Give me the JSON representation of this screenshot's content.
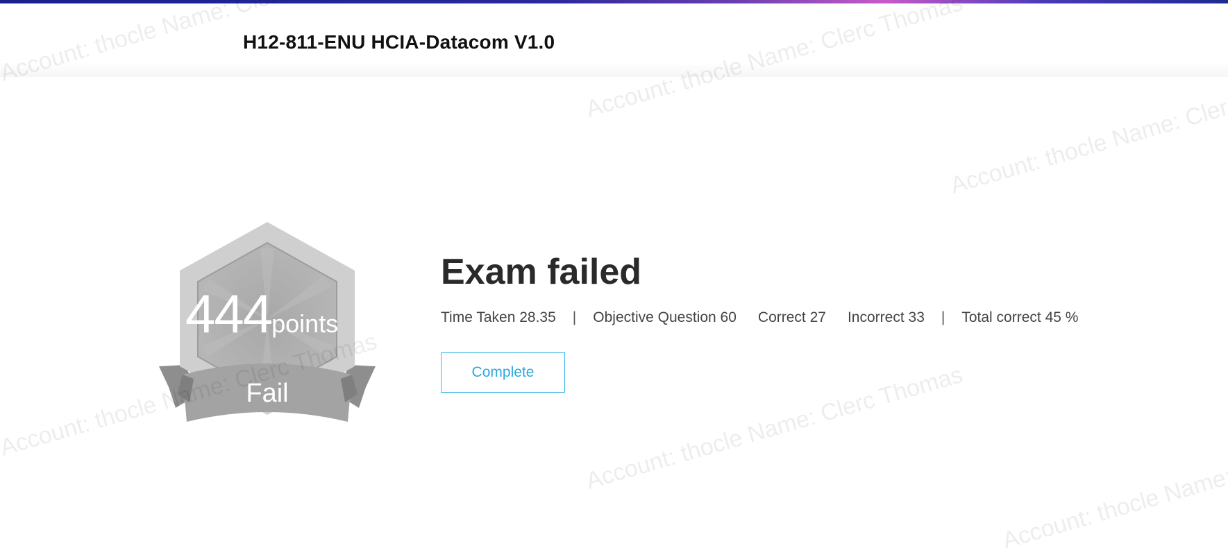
{
  "header": {
    "exam_title": "H12-811-ENU HCIA-Datacom V1.0"
  },
  "watermark": {
    "text": "Account: thocle Name: Clerc Thomas"
  },
  "badge": {
    "score": "444",
    "unit": "points",
    "result": "Fail",
    "color": "#b3b3b3"
  },
  "result": {
    "heading": "Exam failed",
    "time_taken_label": "Time Taken",
    "time_taken_value": "28.35",
    "objective_label": "Objective Question",
    "objective_value": "60",
    "correct_label": "Correct",
    "correct_value": "27",
    "incorrect_label": "Incorrect",
    "incorrect_value": "33",
    "total_label": "Total correct",
    "total_value": "45 %",
    "separator": "|"
  },
  "actions": {
    "complete_label": "Complete"
  },
  "colors": {
    "accent": "#35b6e8",
    "heading": "#2a2a2a"
  }
}
